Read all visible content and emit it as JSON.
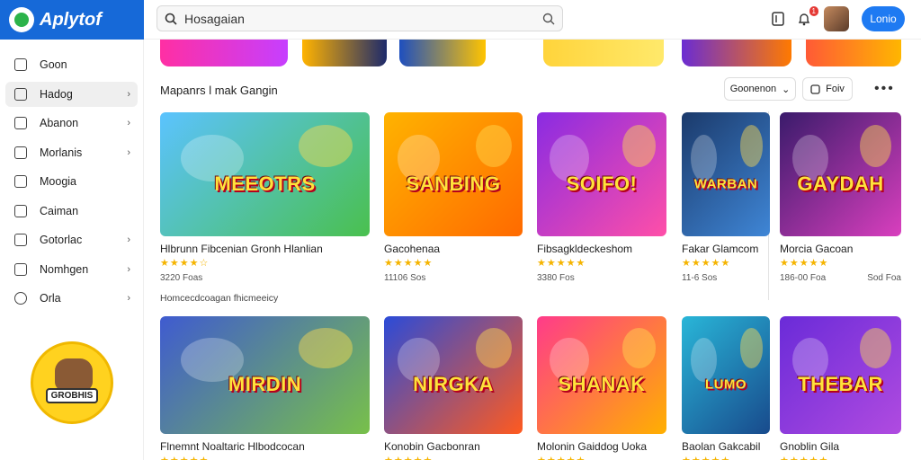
{
  "brand": {
    "name": "Aplytof"
  },
  "search": {
    "value": "Hosagaian",
    "placeholder": ""
  },
  "header": {
    "notif_count": "1",
    "cta_label": "Lonio"
  },
  "sidebar": {
    "items": [
      {
        "label": "Goon",
        "chevron": false,
        "active": false,
        "icon": "home-icon"
      },
      {
        "label": "Hadog",
        "chevron": true,
        "active": true,
        "icon": "tag-icon"
      },
      {
        "label": "Abanon",
        "chevron": true,
        "active": false,
        "icon": "triangle-icon"
      },
      {
        "label": "Morlanis",
        "chevron": true,
        "active": false,
        "icon": "box-icon"
      },
      {
        "label": "Moogia",
        "chevron": false,
        "active": false,
        "icon": "document-icon"
      },
      {
        "label": "Caiman",
        "chevron": false,
        "active": false,
        "icon": "square-icon"
      },
      {
        "label": "Gotorlac",
        "chevron": true,
        "active": false,
        "icon": "grid-icon"
      },
      {
        "label": "Nomhgen",
        "chevron": true,
        "active": false,
        "icon": "tag-icon"
      },
      {
        "label": "Orla",
        "chevron": true,
        "active": false,
        "icon": "circle-icon"
      }
    ],
    "promo_label": "GROBHIS"
  },
  "section": {
    "title": "Mapanrs l mak Gangin",
    "sort_label": "Goonenon",
    "filter_label": "Foiv",
    "note": "Homcecdcoagan fhicmeeicy"
  },
  "banners": [
    {
      "colors": [
        "#ff2fa3",
        "#c63fff"
      ]
    },
    {
      "colors": [
        "#ffb300",
        "#1d2a6b"
      ]
    },
    {
      "colors": [
        "#1e4fbf",
        "#ffc400"
      ]
    },
    {
      "colors": [
        "#ffd43b",
        "#ffe96b"
      ]
    },
    {
      "colors": [
        "#6b2cd2",
        "#ff7a00"
      ]
    },
    {
      "colors": [
        "#ff5a36",
        "#ffb600"
      ]
    }
  ],
  "games_row1": [
    {
      "title": "Hlbrunn Fibcenian Gronh Hlanlian",
      "stars": "★★★★☆",
      "meta_left": "3220 Foas",
      "meta_right": "",
      "art": "MEEOTRS",
      "colors": [
        "#5bc3ff",
        "#4ac04e"
      ]
    },
    {
      "title": "Gacohenaa",
      "stars": "★★★★★",
      "meta_left": "11106 Sos",
      "meta_right": "",
      "art": "SANBING",
      "colors": [
        "#ffb300",
        "#ff6a00"
      ]
    },
    {
      "title": "Fibsagkldeckeshom",
      "stars": "★★★★★",
      "meta_left": "3380 Fos",
      "meta_right": "",
      "art": "SOIFO!",
      "colors": [
        "#8a2be2",
        "#ff4fa8"
      ]
    },
    {
      "title": "Fakar Glamcom",
      "stars": "★★★★★",
      "meta_left": "11-6 Sos",
      "meta_right": "",
      "art": "WARBAN",
      "colors": [
        "#1b3a6b",
        "#3f86d6"
      ]
    },
    {
      "title": "Morcia Gacoan",
      "stars": "★★★★★",
      "meta_left": "186-00 Foa",
      "meta_right": "Sod Foa",
      "art": "GAYDAH",
      "colors": [
        "#3a1b6b",
        "#d93fbe"
      ]
    }
  ],
  "games_row2": [
    {
      "title": "Flnemnt Noaltaric Hlbodcocan",
      "stars": "★★★★★",
      "meta_left": "",
      "meta_right": "",
      "art": "MIRDIN",
      "colors": [
        "#3f5bd0",
        "#78c04a"
      ]
    },
    {
      "title": "Konobin Gacbonran",
      "stars": "★★★★★",
      "meta_left": "",
      "meta_right": "",
      "art": "NIRGKA",
      "colors": [
        "#2b4bd8",
        "#ff5a1f"
      ]
    },
    {
      "title": "Molonin Gaiddog Uoka",
      "stars": "★★★★★",
      "meta_left": "",
      "meta_right": "",
      "art": "SHANAK",
      "colors": [
        "#ff3b8a",
        "#ffb000"
      ]
    },
    {
      "title": "Baolan Gakcabil",
      "stars": "★★★★★",
      "meta_left": "",
      "meta_right": "",
      "art": "LUMO",
      "colors": [
        "#29b6d8",
        "#184a8c"
      ]
    },
    {
      "title": "Gnoblin Gila",
      "stars": "★★★★★",
      "meta_left": "",
      "meta_right": "",
      "art": "THEBAR",
      "colors": [
        "#6a2bd8",
        "#b04be0"
      ]
    }
  ]
}
